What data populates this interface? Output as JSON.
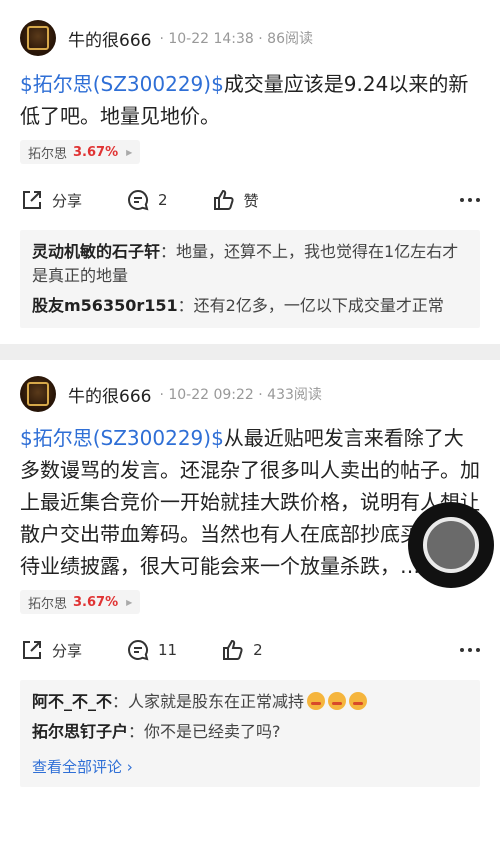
{
  "posts": [
    {
      "username": "牛的很666",
      "meta": "· 10-22 14:38 · 86阅读",
      "stock_link": "$拓尔思(SZ300229)$",
      "text": "成交量应该是9.24以来的新低了吧。地量见地价。",
      "tag": {
        "name": "拓尔思",
        "pct": "3.67%"
      },
      "actions": {
        "share": "分享",
        "comments": "2",
        "like": "赞"
      },
      "comments": [
        {
          "user": "灵动机敏的石子轩",
          "text": "：地量，还算不上，我也觉得在1亿左右才是真正的地量"
        },
        {
          "user": "股友m56350r151",
          "text": "：还有2亿多，一亿以下成交量才正常"
        }
      ]
    },
    {
      "username": "牛的很666",
      "meta": "· 10-22 09:22 · 433阅读",
      "stock_link": "$拓尔思(SZ300229)$",
      "text": "从最近贴吧发言来看除了大多数谩骂的发言。还混杂了很多叫人卖出的帖子。加上最近集合竞价一开始就挂大跌价格，说明有人想让散户交出带血筹码。当然也有人在底部抄底买入。静待业绩披露，很大可能会来一个放量杀跌，…",
      "tag": {
        "name": "拓尔思",
        "pct": "3.67%"
      },
      "actions": {
        "share": "分享",
        "comments": "11",
        "like": "2"
      },
      "comments": [
        {
          "user": "阿不_不_不",
          "text": "：人家就是股东在正常减持"
        },
        {
          "user": "拓尔思钉子户",
          "text": "：你不是已经卖了吗?"
        }
      ],
      "view_all": "查看全部评论 ›"
    }
  ],
  "colors": {
    "link": "#2f6fd6",
    "up": "#e03434"
  }
}
